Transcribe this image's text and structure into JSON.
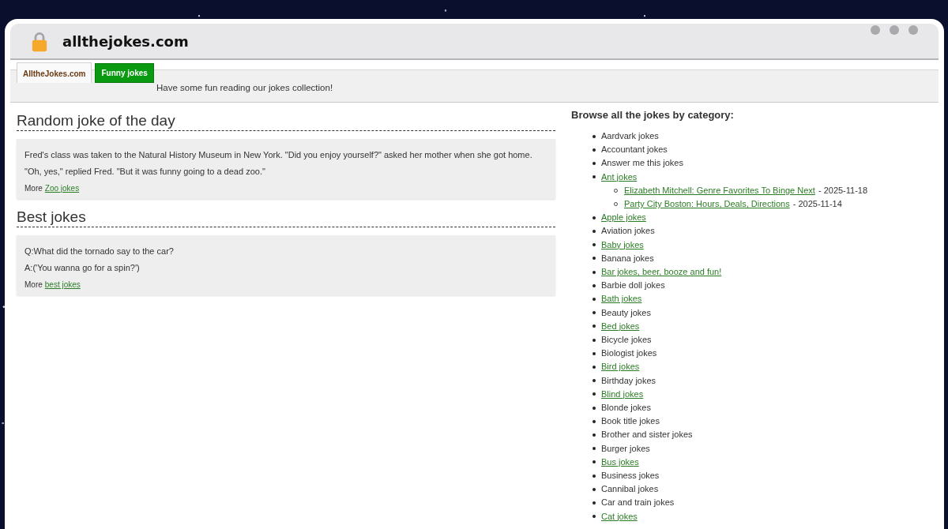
{
  "browser": {
    "address": "allthejokes.com"
  },
  "header": {
    "tabs": [
      {
        "label": "AlltheJokes.com",
        "selected": true
      },
      {
        "label": "Funny jokes",
        "selected": false
      }
    ],
    "tagline": "Have some fun reading our jokes collection!"
  },
  "sections": [
    {
      "heading": "Random joke of the day",
      "lines": [
        "Fred's class was taken to the Natural History Museum in New York. \"Did you enjoy yourself?\" asked her mother when she got home.",
        "\"Oh, yes,\" replied Fred. \"But it was funny going to a dead zoo.\""
      ],
      "more_label": "More",
      "more_link": "Zoo jokes"
    },
    {
      "heading": "Best jokes",
      "lines": [
        "Q:What did the tornado say to the car?",
        "A:('You wanna go for a spin?')"
      ],
      "more_label": "More",
      "more_link": "best jokes"
    }
  ],
  "categories": {
    "heading": "Browse all the jokes by category:",
    "items": [
      {
        "label": "Aardvark jokes",
        "kind": "text"
      },
      {
        "label": "Accountant jokes",
        "kind": "text"
      },
      {
        "label": "Answer me this jokes",
        "kind": "text"
      },
      {
        "label": "Ant jokes",
        "kind": "link",
        "children": [
          {
            "label": "Elizabeth Mitchell: Genre Favorites To Binge Next",
            "kind": "link",
            "note": "- 2025-11-18"
          },
          {
            "label": "Party City Boston: Hours, Deals, Directions",
            "kind": "link",
            "note": "- 2025-11-14"
          }
        ]
      },
      {
        "label": "Apple jokes",
        "kind": "link"
      },
      {
        "label": "Aviation jokes",
        "kind": "text"
      },
      {
        "label": "Baby jokes",
        "kind": "link"
      },
      {
        "label": "Banana jokes",
        "kind": "text"
      },
      {
        "label": "Bar jokes, beer, booze and fun!",
        "kind": "link"
      },
      {
        "label": "Barbie doll jokes",
        "kind": "text"
      },
      {
        "label": "Bath jokes",
        "kind": "link"
      },
      {
        "label": "Beauty jokes",
        "kind": "text"
      },
      {
        "label": "Bed jokes",
        "kind": "link"
      },
      {
        "label": "Bicycle jokes",
        "kind": "text"
      },
      {
        "label": "Biologist jokes",
        "kind": "text"
      },
      {
        "label": "Bird jokes",
        "kind": "link"
      },
      {
        "label": "Birthday jokes",
        "kind": "text"
      },
      {
        "label": "Blind jokes",
        "kind": "link"
      },
      {
        "label": "Blonde jokes",
        "kind": "text"
      },
      {
        "label": "Book title jokes",
        "kind": "text"
      },
      {
        "label": "Brother and sister jokes",
        "kind": "text"
      },
      {
        "label": "Burger jokes",
        "kind": "text"
      },
      {
        "label": "Bus jokes",
        "kind": "link"
      },
      {
        "label": "Business jokes",
        "kind": "text"
      },
      {
        "label": "Cannibal jokes",
        "kind": "text"
      },
      {
        "label": "Car and train jokes",
        "kind": "text"
      },
      {
        "label": "Cat jokes",
        "kind": "link"
      }
    ]
  }
}
